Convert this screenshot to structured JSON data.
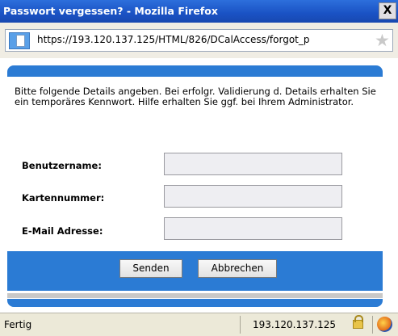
{
  "window": {
    "title": "Passwort vergessen? - Mozilla Firefox",
    "close_label": "X"
  },
  "address_bar": {
    "url": "https://193.120.137.125/HTML/826/DCalAccess/forgot_p"
  },
  "form": {
    "instructions": "Bitte folgende Details angeben. Bei erfolgr. Validierung d. Details erhalten Sie ein temporäres Kennwort. Hilfe erhalten Sie ggf. bei Ihrem Administrator.",
    "fields": [
      {
        "label": "Benutzername:",
        "value": ""
      },
      {
        "label": "Kartennummer:",
        "value": ""
      },
      {
        "label": "E-Mail Adresse:",
        "value": ""
      }
    ],
    "buttons": {
      "submit": "Senden",
      "cancel": "Abbrechen"
    }
  },
  "status_bar": {
    "status": "Fertig",
    "host": "193.120.137.125"
  },
  "icons": {
    "page": "page-icon",
    "bookmark": "star-icon",
    "security": "lock-icon",
    "addon": "firefox-globe-icon"
  },
  "colors": {
    "titlebar": "#1a52c4",
    "accent_bar": "#2b7bd4",
    "input_bg": "#eeeef2"
  }
}
